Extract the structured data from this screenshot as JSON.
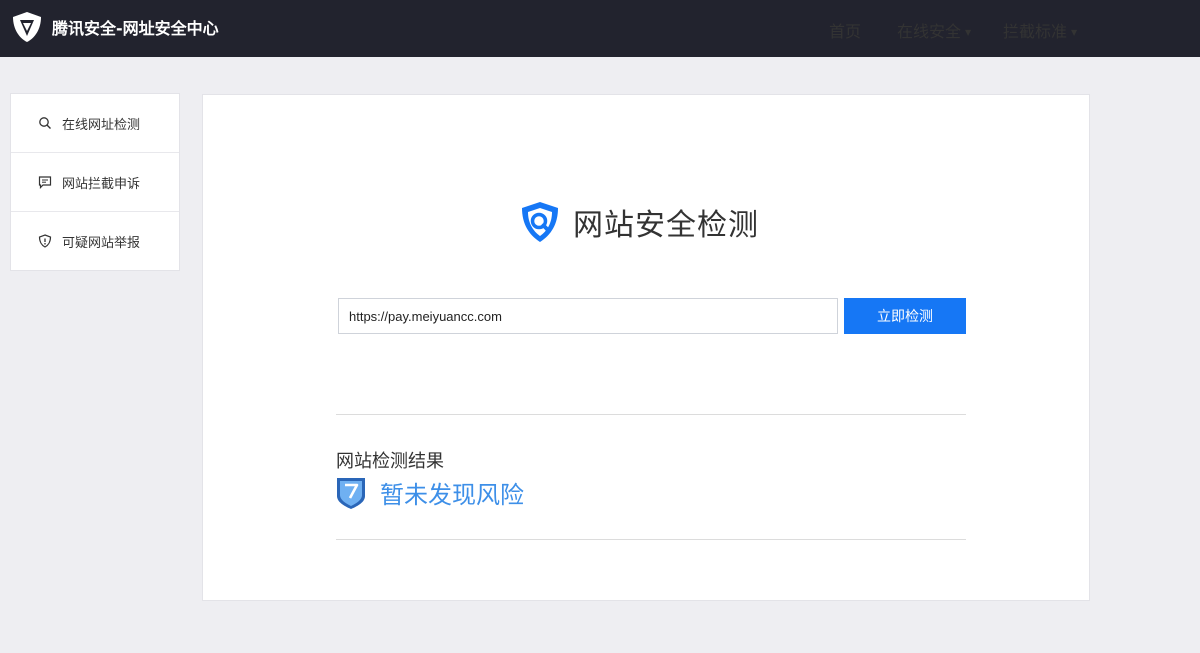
{
  "header": {
    "site_title": "腾讯安全-网址安全中心",
    "logo_icon": "tencent-security-shield-icon",
    "nav": [
      {
        "label": "首页",
        "has_dropdown": false
      },
      {
        "label": "在线安全",
        "has_dropdown": true
      },
      {
        "label": "拦截标准",
        "has_dropdown": true
      }
    ],
    "dropdown_caret": "▼"
  },
  "sidebar": {
    "items": [
      {
        "label": "在线网址检测",
        "icon": "search-icon"
      },
      {
        "label": "网站拦截申诉",
        "icon": "chat-icon"
      },
      {
        "label": "可疑网站举报",
        "icon": "shield-alert-icon"
      }
    ]
  },
  "main": {
    "title": "网站安全检测",
    "title_icon": "shield-search-icon",
    "url_value": "https://pay.meiyuancc.com",
    "check_button": "立即检测",
    "result_label": "网站检测结果",
    "result_value": "暂未发现风险",
    "result_icon": "shield-check-icon"
  },
  "colors": {
    "topbar": "#22232e",
    "accent": "#1677f5",
    "result_text": "#3d8fe8",
    "page_bg": "#eeeef2"
  }
}
